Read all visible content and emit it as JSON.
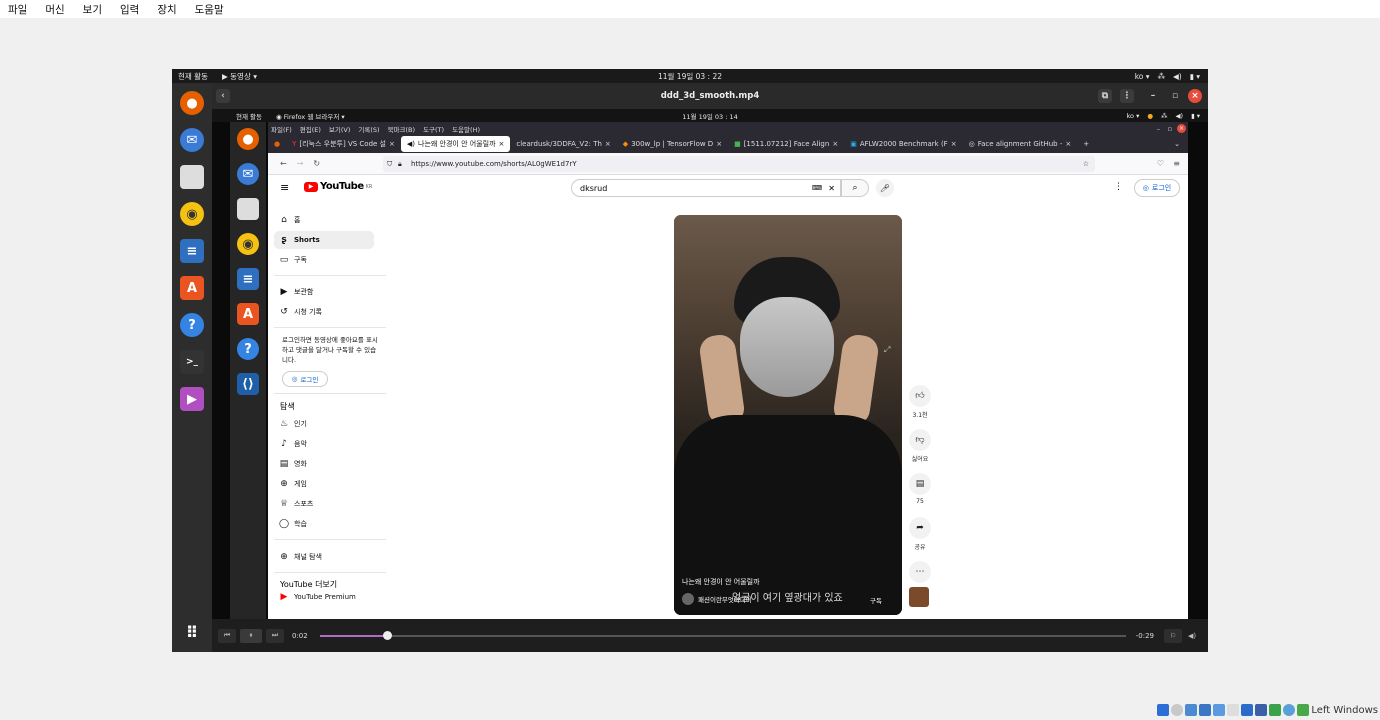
{
  "host_menu": [
    "파일",
    "머신",
    "보기",
    "입력",
    "장치",
    "도움말"
  ],
  "outer_topbar": {
    "activities": "현재 활동",
    "app_menu": "동영상",
    "clock": "11월 19일 03 : 22",
    "lang": "ko"
  },
  "player": {
    "title": "ddd_3d_smooth.mp4",
    "time_current": "0:02",
    "time_remaining": "-0:29",
    "progress": 0.083
  },
  "inner_topbar": {
    "activities": "현재 활동",
    "app_menu": "Firefox 웹 브라우저",
    "clock": "11월 19일 03 : 14",
    "lang": "ko"
  },
  "firefox_menu": [
    "파일(F)",
    "편집(E)",
    "보기(V)",
    "기록(S)",
    "북마크(B)",
    "도구(T)",
    "도움말(H)"
  ],
  "tabs": [
    {
      "label": "[리눅스 우분투] VS Code 설"
    },
    {
      "label": "나는왜 안경이 안 어울릴까"
    },
    {
      "label": "cleardusk/3DDFA_V2: Th"
    },
    {
      "label": "300w_lp | TensorFlow D"
    },
    {
      "label": "[1511.07212] Face Align"
    },
    {
      "label": "AFLW2000 Benchmark (F"
    },
    {
      "label": "Face alignment GitHub -"
    }
  ],
  "url": "https://www.youtube.com/shorts/AL0gWE1d7rY",
  "youtube": {
    "logo": "YouTube",
    "region": "KR",
    "search_value": "dksrud",
    "login": "로그인",
    "nav": [
      {
        "label": "홈"
      },
      {
        "label": "Shorts"
      },
      {
        "label": "구독"
      }
    ],
    "nav2": [
      {
        "label": "보관함"
      },
      {
        "label": "시청 기록"
      }
    ],
    "login_prompt": "로그인하면 동영상에 좋아요를 표시하고 댓글을 달거나 구독할 수 있습니다.",
    "login_button": "로그인",
    "explore_title": "탐색",
    "explore": [
      {
        "label": "인기"
      },
      {
        "label": "음악"
      },
      {
        "label": "영화"
      },
      {
        "label": "게임"
      },
      {
        "label": "스포츠"
      },
      {
        "label": "학습"
      }
    ],
    "browse_channels": "채널 탐색",
    "more_title": "YouTube 더보기",
    "more_first": "YouTube Premium",
    "short_title": "나는왜 안경이 안 어울릴까",
    "short_channel": "패션이란무엇이디이",
    "short_caption": "얼굴이 여기 옆광대가 있죠",
    "subscribe": "구독",
    "likes": "3.1천",
    "dislike": "싫어요",
    "comments": "75",
    "share": "공유"
  },
  "taskbar_label": "Left Windows"
}
